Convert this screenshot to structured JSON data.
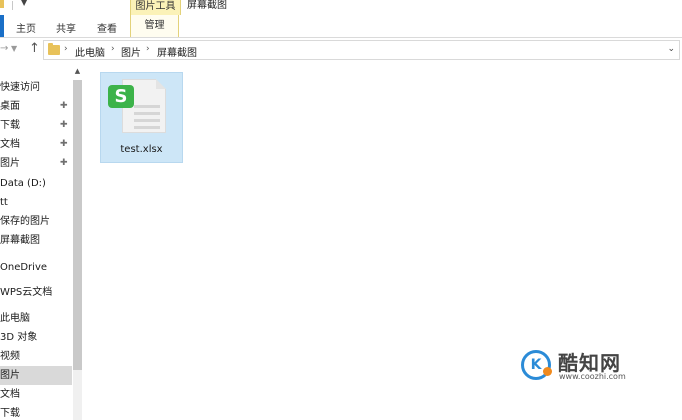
{
  "window": {
    "title": "屏幕截图",
    "contextual_tab_group": "图片工具"
  },
  "ribbon": {
    "tabs": [
      "主页",
      "共享",
      "查看"
    ],
    "contextual_tab": "管理"
  },
  "address_bar": {
    "breadcrumbs": [
      "此电脑",
      "图片",
      "屏幕截图"
    ]
  },
  "nav_pane": {
    "items": [
      {
        "label": "快速访问",
        "pinned": false,
        "selected": false
      },
      {
        "label": "桌面",
        "pinned": true,
        "selected": false
      },
      {
        "label": "下载",
        "pinned": true,
        "selected": false
      },
      {
        "label": "文档",
        "pinned": true,
        "selected": false
      },
      {
        "label": "图片",
        "pinned": true,
        "selected": false
      },
      {
        "label": "Data (D:)",
        "pinned": false,
        "selected": false
      },
      {
        "label": "tt",
        "pinned": false,
        "selected": false
      },
      {
        "label": "保存的图片",
        "pinned": false,
        "selected": false
      },
      {
        "label": "屏幕截图",
        "pinned": false,
        "selected": false
      },
      {
        "label": "OneDrive",
        "pinned": false,
        "selected": false
      },
      {
        "label": "WPS云文档",
        "pinned": false,
        "selected": false
      },
      {
        "label": "此电脑",
        "pinned": false,
        "selected": false
      },
      {
        "label": "3D 对象",
        "pinned": false,
        "selected": false
      },
      {
        "label": "视频",
        "pinned": false,
        "selected": false
      },
      {
        "label": "图片",
        "pinned": false,
        "selected": true
      },
      {
        "label": "文档",
        "pinned": false,
        "selected": false
      },
      {
        "label": "下载",
        "pinned": false,
        "selected": false
      }
    ]
  },
  "files": [
    {
      "name": "test.xlsx",
      "icon": "wps-spreadsheet-icon",
      "badge": "S",
      "selected": true
    }
  ],
  "watermark": {
    "title": "酷知网",
    "url": "www.coozhi.com",
    "logo_text": "K"
  },
  "colors": {
    "selection": "#cde6f7",
    "contextual_tab": "#fbf2b8",
    "wps_green": "#3cb34a",
    "folder": "#e8c25a"
  }
}
